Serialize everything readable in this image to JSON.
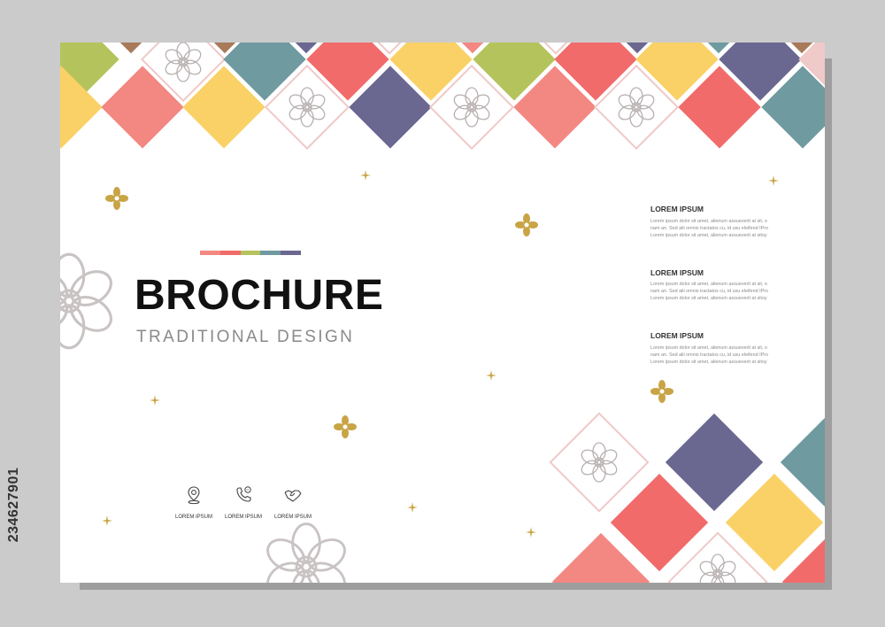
{
  "brochure": {
    "title": "BROCHURE",
    "subtitle": "TRADITIONAL DESIGN"
  },
  "colors": {
    "coral": "#f38781",
    "red": "#f26b6b",
    "yellow": "#fad166",
    "navy": "#6a6791",
    "teal": "#6f9aa0",
    "olive": "#b5c35c",
    "brown": "#a87a5a",
    "pink_outline": "#f0c9c9",
    "gold": "#c9a445"
  },
  "stripe_colors": [
    "#f38781",
    "#f26b6b",
    "#b5c35c",
    "#6f9aa0",
    "#6a6791"
  ],
  "info_blocks": [
    {
      "heading": "LOREM IPSUM",
      "lines": [
        "Lorem ipsum dolor sit amet, alienum assueverit at sit, o",
        "nam an. Sed alii omnis tractatos cu, id usu eleifend IPro",
        "Lorem ipsum dolor sit amet, alienum assueverit at sitoy"
      ]
    },
    {
      "heading": "LOREM IPSUM",
      "lines": [
        "Lorem ipsum dolor sit amet, alienum assueverit at sit, o",
        "nam an. Sed alii omnis tractatos cu, id usu eleifend IPro",
        "Lorem ipsum dolor sit amet, alienum assueverit at sitoy"
      ]
    },
    {
      "heading": "LOREM IPSUM",
      "lines": [
        "Lorem ipsum dolor sit amet, alienum assueverit at sit, o",
        "nam an. Sed alii omnis tractatos cu, id usu eleifend IPro",
        "Lorem ipsum dolor sit amet, alienum assueverit at sitoy"
      ]
    }
  ],
  "contacts": [
    {
      "icon": "location-pin-icon",
      "label": "LOREM IPSUM"
    },
    {
      "icon": "phone-icon",
      "label": "LOREM IPSUM"
    },
    {
      "icon": "handshake-icon",
      "label": "LOREM IPSUM"
    }
  ],
  "stock_id": "234627901"
}
